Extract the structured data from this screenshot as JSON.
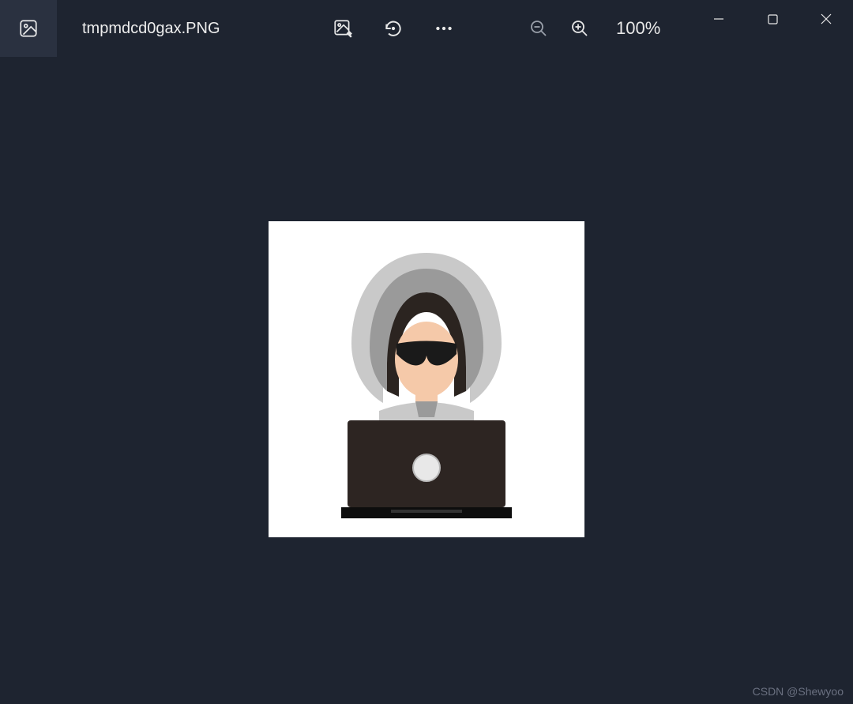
{
  "header": {
    "file_title": "tmpmdcd0gax.PNG",
    "zoom_level": "100%"
  },
  "watermark": "CSDN @Shewyoo",
  "icons": {
    "app": "photos-app-icon",
    "edit": "edit-image-icon",
    "rotate": "rotate-icon",
    "more": "more-icon",
    "zoom_out": "zoom-out-icon",
    "zoom_in": "zoom-in-icon",
    "minimize": "minimize-icon",
    "maximize": "maximize-icon",
    "close": "close-icon"
  },
  "image_content": {
    "description": "hacker-with-laptop-illustration",
    "colors": {
      "hood_light": "#c9c9c9",
      "hood_dark": "#9a9a9a",
      "hair": "#2b2420",
      "skin": "#f5c9a9",
      "glasses": "#1a1a1a",
      "laptop": "#2d2522",
      "laptop_logo": "#e8e8e8",
      "laptop_base": "#0d0d0d"
    }
  }
}
